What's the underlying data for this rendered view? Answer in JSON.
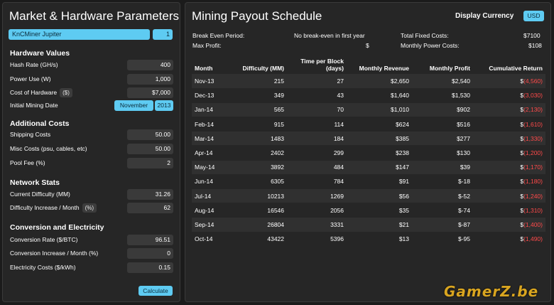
{
  "left": {
    "title": "Market & Hardware Parameters",
    "rig_select": "KnCMiner Jupiter",
    "rig_count": "1",
    "hardware_heading": "Hardware Values",
    "hash_rate_label": "Hash Rate (GH/s)",
    "hash_rate_value": "400",
    "power_label": "Power Use (W)",
    "power_value": "1,000",
    "cost_label": "Cost of Hardware",
    "cost_unit": "($)",
    "cost_value": "$7,000",
    "mining_date_label": "Initial Mining Date",
    "mining_month": "November",
    "mining_year": "2013",
    "additional_heading": "Additional Costs",
    "shipping_label": "Shipping Costs",
    "shipping_value": "50.00",
    "misc_label": "Misc Costs (psu, cables, etc)",
    "misc_value": "50.00",
    "pool_label": "Pool Fee (%)",
    "pool_value": "2",
    "network_heading": "Network Stats",
    "difficulty_label": "Current Difficulty (MM)",
    "difficulty_value": "31.26",
    "diff_increase_label": "Difficulty Increase / Month",
    "diff_increase_unit": "(%)",
    "diff_increase_value": "62",
    "conversion_heading": "Conversion and Electricity",
    "conv_rate_label": "Conversion Rate ($/BTC)",
    "conv_rate_value": "96.51",
    "conv_increase_label": "Conversion Increase / Month (%)",
    "conv_increase_value": "0",
    "electricity_label": "Electricity Costs ($/kWh)",
    "electricity_value": "0.15",
    "calculate_label": "Calculate"
  },
  "right": {
    "title": "Mining Payout Schedule",
    "currency_label": "Display Currency",
    "currency_value": "USD",
    "break_even_label": "Break Even Period:",
    "break_even_value": "No break-even in first year",
    "max_profit_label": "Max Profit:",
    "max_profit_value": "$",
    "fixed_costs_label": "Total Fixed Costs:",
    "fixed_costs_value": "$7100",
    "power_costs_label": "Monthly Power Costs:",
    "power_costs_value": "$108",
    "columns": [
      "Month",
      "Difficulty (MM)",
      "Time per Block (days)",
      "Monthly Revenue",
      "Monthly Profit",
      "Cumulative Return"
    ],
    "rows": [
      {
        "month": "Nov-13",
        "difficulty": "215",
        "time": "27",
        "revenue": "$2,650",
        "profit": "$2,540",
        "cum_prefix": "$",
        "cum_value": "(4,560)"
      },
      {
        "month": "Dec-13",
        "difficulty": "349",
        "time": "43",
        "revenue": "$1,640",
        "profit": "$1,530",
        "cum_prefix": "$",
        "cum_value": "(3,030)"
      },
      {
        "month": "Jan-14",
        "difficulty": "565",
        "time": "70",
        "revenue": "$1,010",
        "profit": "$902",
        "cum_prefix": "$",
        "cum_value": "(2,130)"
      },
      {
        "month": "Feb-14",
        "difficulty": "915",
        "time": "114",
        "revenue": "$624",
        "profit": "$516",
        "cum_prefix": "$",
        "cum_value": "(1,610)"
      },
      {
        "month": "Mar-14",
        "difficulty": "1483",
        "time": "184",
        "revenue": "$385",
        "profit": "$277",
        "cum_prefix": "$",
        "cum_value": "(1,330)"
      },
      {
        "month": "Apr-14",
        "difficulty": "2402",
        "time": "299",
        "revenue": "$238",
        "profit": "$130",
        "cum_prefix": "$",
        "cum_value": "(1,200)"
      },
      {
        "month": "May-14",
        "difficulty": "3892",
        "time": "484",
        "revenue": "$147",
        "profit": "$39",
        "cum_prefix": "$",
        "cum_value": "(1,170)"
      },
      {
        "month": "Jun-14",
        "difficulty": "6305",
        "time": "784",
        "revenue": "$91",
        "profit": "$-18",
        "cum_prefix": "$",
        "cum_value": "(1,180)"
      },
      {
        "month": "Jul-14",
        "difficulty": "10213",
        "time": "1269",
        "revenue": "$56",
        "profit": "$-52",
        "cum_prefix": "$",
        "cum_value": "(1,240)"
      },
      {
        "month": "Aug-14",
        "difficulty": "16546",
        "time": "2056",
        "revenue": "$35",
        "profit": "$-74",
        "cum_prefix": "$",
        "cum_value": "(1,310)"
      },
      {
        "month": "Sep-14",
        "difficulty": "26804",
        "time": "3331",
        "revenue": "$21",
        "profit": "$-87",
        "cum_prefix": "$",
        "cum_value": "(1,400)"
      },
      {
        "month": "Oct-14",
        "difficulty": "43422",
        "time": "5396",
        "revenue": "$13",
        "profit": "$-95",
        "cum_prefix": "$",
        "cum_value": "(1,490)"
      }
    ]
  },
  "watermark": "GamerZ.be",
  "colors": {
    "accent": "#5ecbf2",
    "negative": "#ff4a4a",
    "panel": "#262626",
    "watermark": "#d9a520"
  }
}
